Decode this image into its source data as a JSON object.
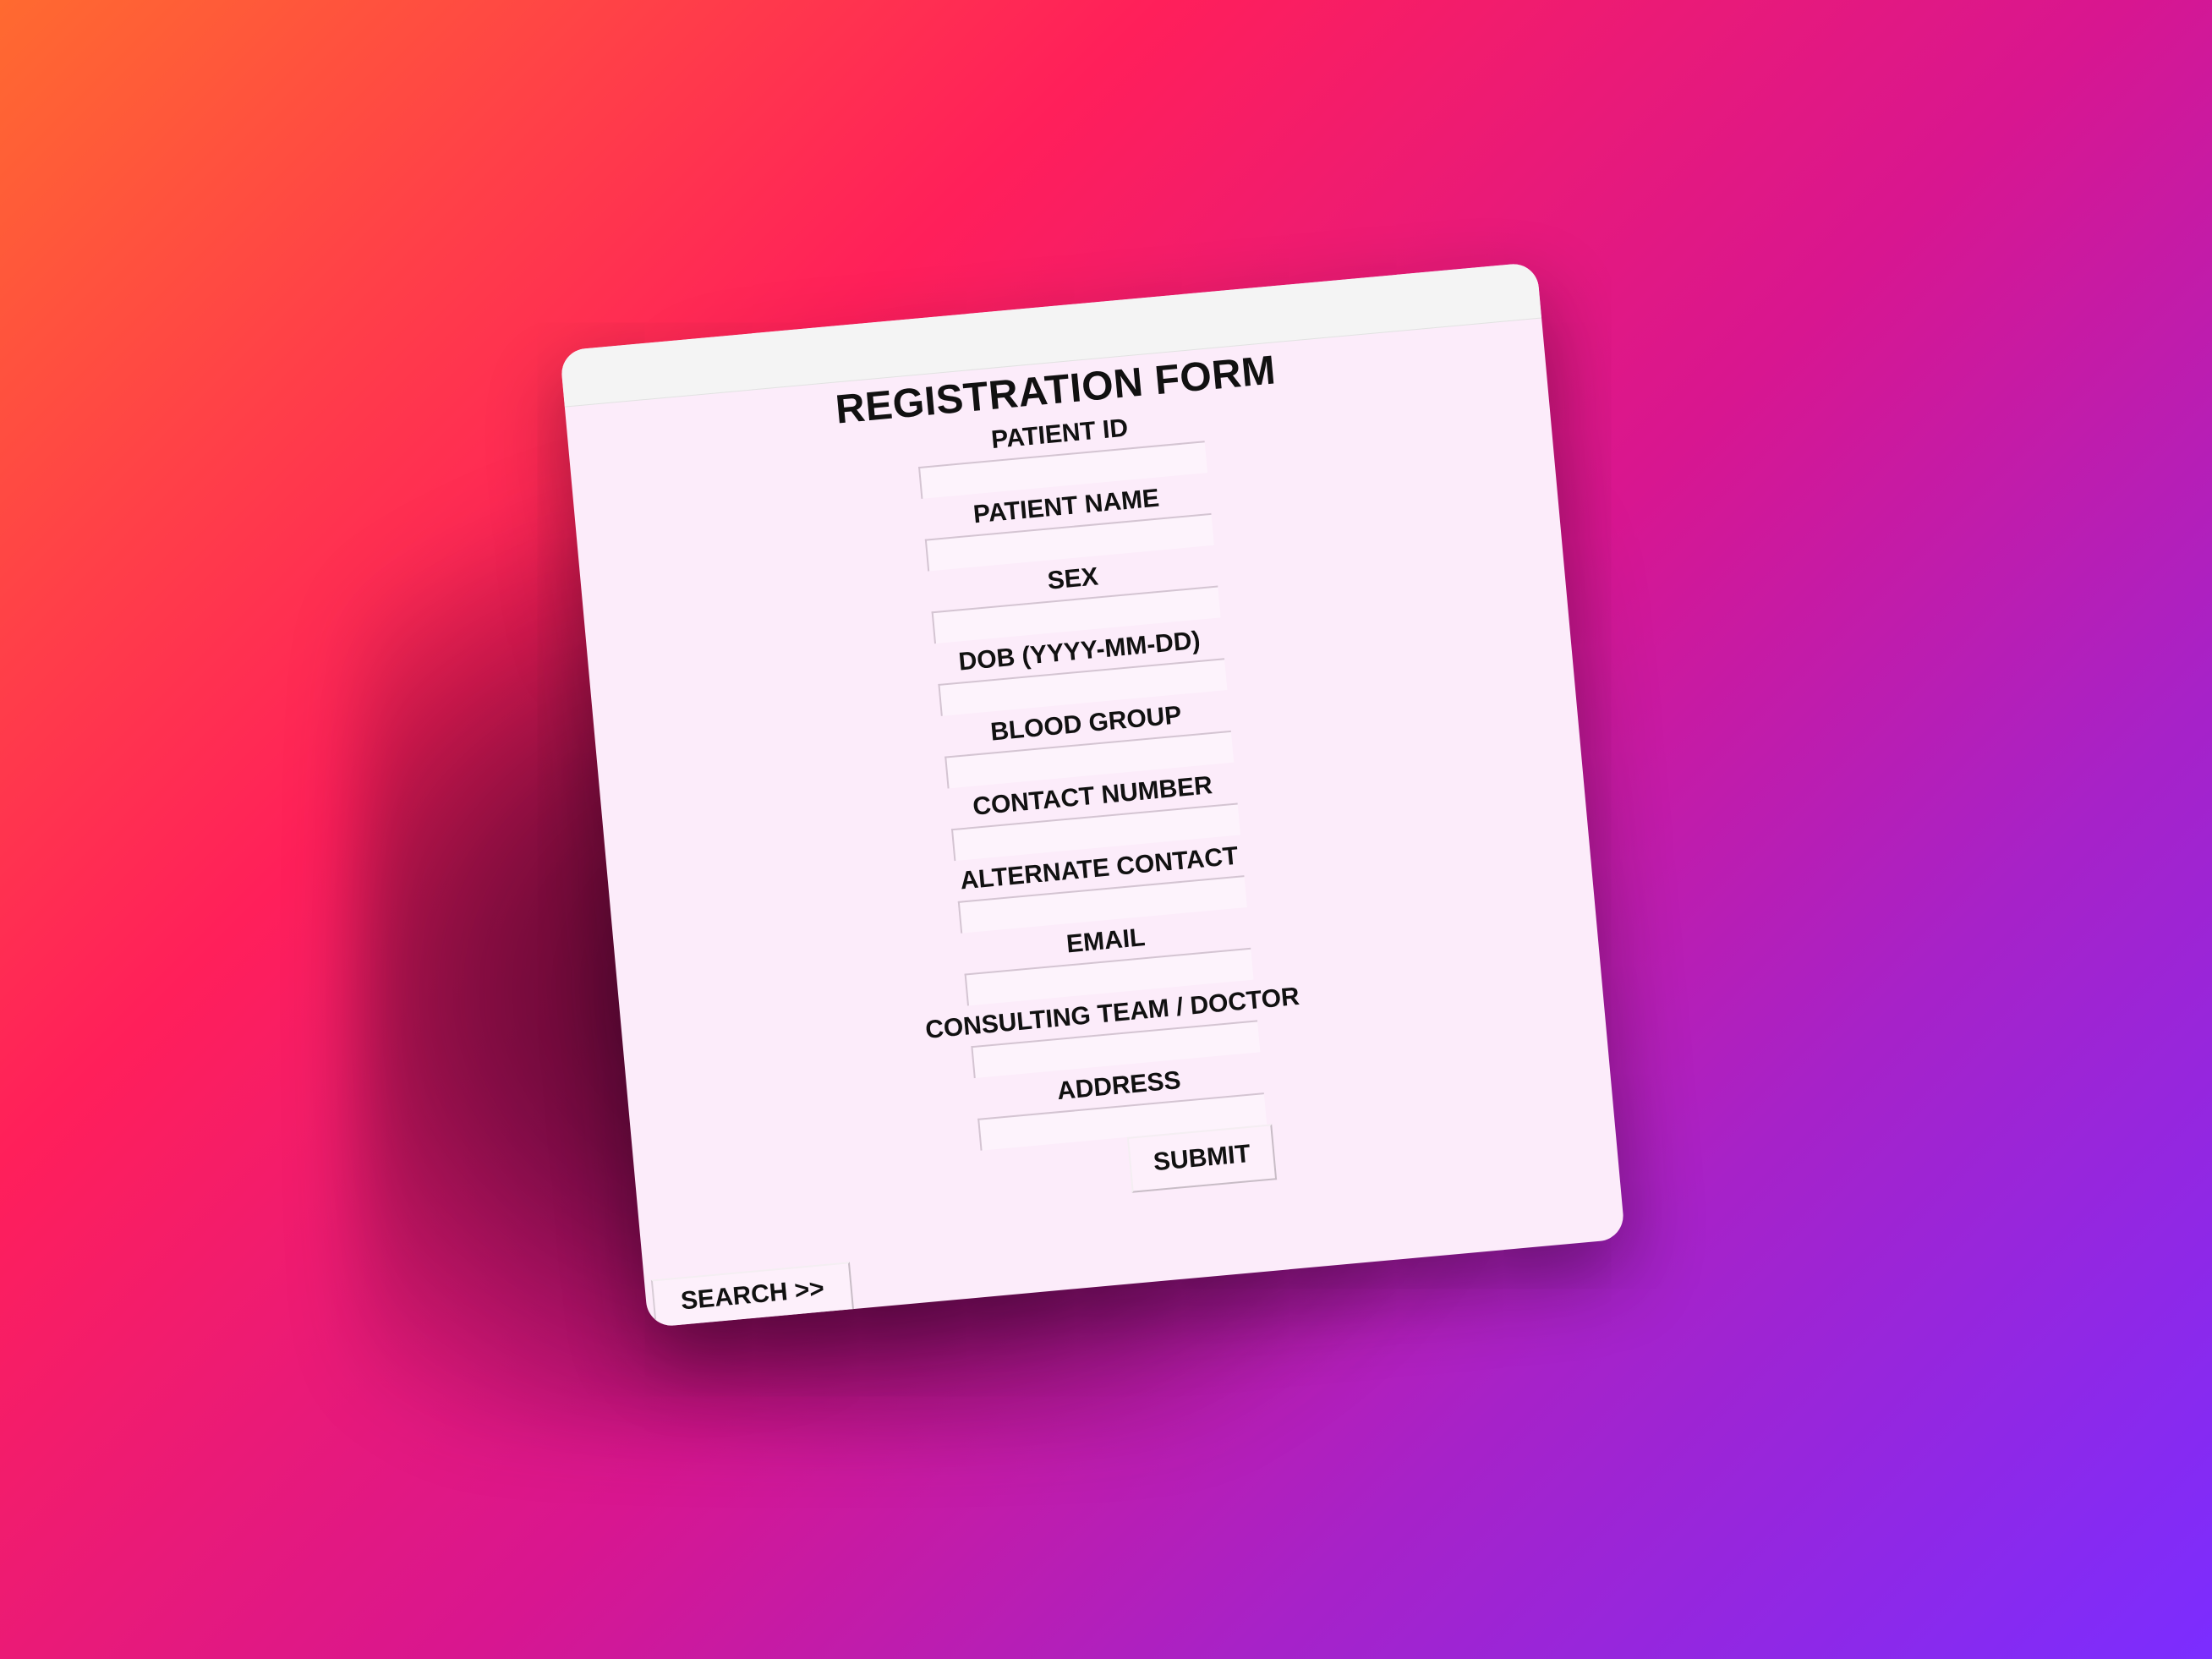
{
  "form": {
    "title": "REGISTRATION FORM",
    "fields": [
      {
        "label": "PATIENT ID",
        "value": ""
      },
      {
        "label": "PATIENT NAME",
        "value": ""
      },
      {
        "label": "SEX",
        "value": ""
      },
      {
        "label": "DOB (YYYY-MM-DD)",
        "value": ""
      },
      {
        "label": "BLOOD GROUP",
        "value": ""
      },
      {
        "label": "CONTACT NUMBER",
        "value": ""
      },
      {
        "label": "ALTERNATE CONTACT",
        "value": ""
      },
      {
        "label": "EMAIL",
        "value": ""
      },
      {
        "label": "CONSULTING TEAM / DOCTOR",
        "value": ""
      },
      {
        "label": "ADDRESS",
        "value": ""
      }
    ],
    "submit_label": "SUBMIT",
    "search_label": "SEARCH >>"
  },
  "colors": {
    "form_background": "#fcecfa",
    "titlebar": "#f4f4f4",
    "background_gradient": [
      "#ff6a30",
      "#ff1f5a",
      "#d81690",
      "#a722c8",
      "#7b2dff"
    ]
  }
}
